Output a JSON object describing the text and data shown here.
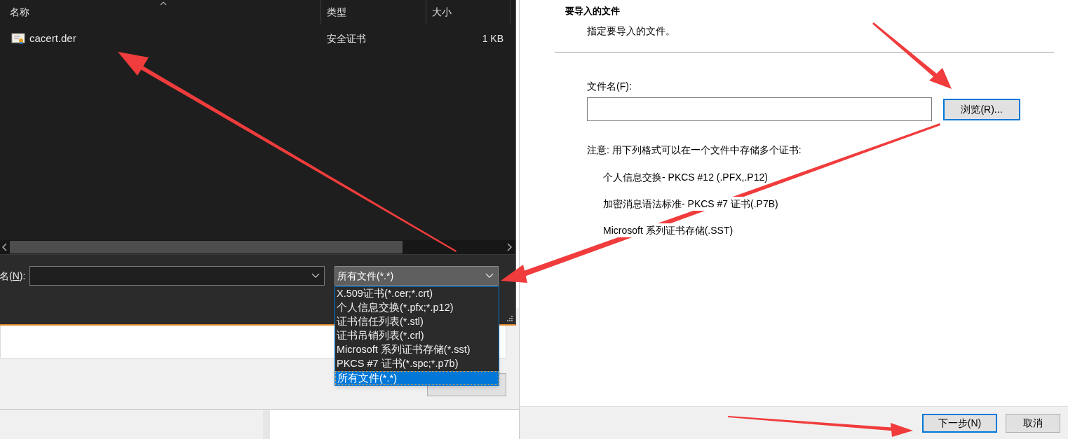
{
  "file_dialog": {
    "columns": [
      {
        "label": "名称"
      },
      {
        "label": "类型"
      },
      {
        "label": "大小"
      }
    ],
    "files": [
      {
        "name": "cacert.der",
        "type": "安全证书",
        "size": "1 KB"
      }
    ],
    "filename_label": {
      "before": "名(",
      "key": "N",
      "after": "):"
    },
    "filetype_value": "所有文件(*.*)",
    "filetype_options": [
      {
        "label": "X.509证书(*.cer;*.crt)",
        "selected": false
      },
      {
        "label": "个人信息交换(*.pfx;*.p12)",
        "selected": false
      },
      {
        "label": "证书信任列表(*.stl)",
        "selected": false
      },
      {
        "label": "证书吊销列表(*.crl)",
        "selected": false
      },
      {
        "label": "Microsoft 系列证书存储(*.sst)",
        "selected": false
      },
      {
        "label": "PKCS #7 证书(*.spc;*.p7b)",
        "selected": false
      },
      {
        "label": "所有文件(*.*)",
        "selected": true
      }
    ]
  },
  "wizard": {
    "heading": "要导入的文件",
    "subheading": "指定要导入的文件。",
    "filename_label": "文件名(F):",
    "browse_button": "浏览(R)...",
    "note": "注意: 用下列格式可以在一个文件中存储多个证书:",
    "formats": [
      "个人信息交换- PKCS #12 (.PFX,.P12)",
      "加密消息语法标准- PKCS #7 证书(.P7B)",
      "Microsoft 系列证书存储(.SST)"
    ],
    "buttons": [
      {
        "label": "下一步(N)",
        "kind": "default"
      },
      {
        "label": "取消",
        "kind": "normal"
      }
    ]
  }
}
